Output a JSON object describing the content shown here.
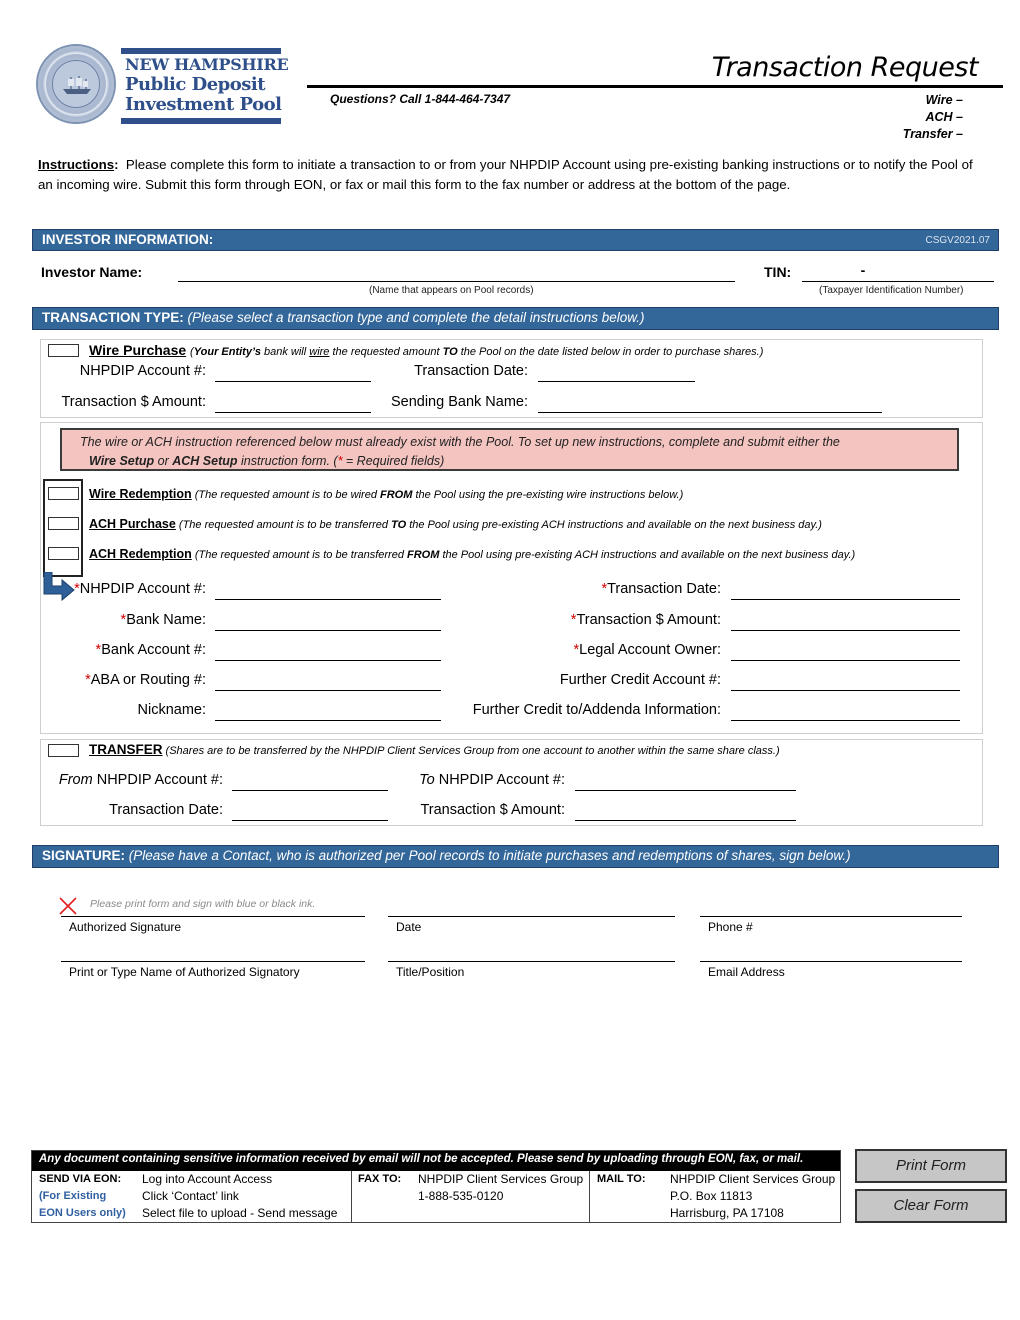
{
  "header": {
    "logo": {
      "line1": "NEW HAMPSHIRE",
      "line2": "Public Deposit",
      "line3": "Investment Pool"
    },
    "title": "Transaction Request",
    "questions": "Questions? Call 1-844-464-7347",
    "types": [
      "Wire –",
      "ACH –",
      "Transfer –"
    ]
  },
  "instructions": {
    "label": "Instructions",
    "text": "Please complete this form to initiate a transaction to or from your NHPDIP Account using pre-existing banking instructions or to notify the Pool of an incoming wire.  Submit this form through EON, or fax or mail this form to the fax number or address at the bottom of the page."
  },
  "investor": {
    "section_title": "INVESTOR INFORMATION:",
    "form_code": "CSGV2021.07",
    "name_label": "Investor Name:",
    "name_value": "",
    "name_hint": "(Name that appears on Pool records)",
    "tin_label": "TIN:",
    "tin_value": "-",
    "tin_hint": "(Taxpayer Identification Number)"
  },
  "transaction_type": {
    "section_title": "TRANSACTION TYPE:",
    "section_sub": "(Please select a transaction type and complete the detail instructions below.)"
  },
  "wire_purchase": {
    "title": "Wire Purchase",
    "desc_pre": "(",
    "desc_bold1": "Your Entity’s",
    "desc_mid1": " bank will ",
    "desc_u": "wire",
    "desc_mid2": " the requested amount ",
    "desc_bold2": "TO",
    "desc_post": " the Pool on the date listed below in order to purchase shares.)",
    "fields": {
      "account": "NHPDIP Account #:",
      "date": "Transaction Date:",
      "amount": "Transaction $ Amount:",
      "bank": "Sending Bank Name:"
    },
    "checked": false
  },
  "notice": {
    "line1": "The wire or ACH instruction referenced below must already exist with the Pool. To set up new instructions, complete and submit either the",
    "wire_setup": "Wire Setup",
    "or": " or ",
    "ach_setup": "ACH Setup",
    "mid": " instruction form. (",
    "star": "*",
    "tail": " = Required fields)"
  },
  "redemption_options": [
    {
      "title": "Wire Redemption",
      "pre": " (The requested amount is to be wired ",
      "bold": "FROM",
      "post": " the Pool using the pre-existing wire instructions below.)",
      "checked": false
    },
    {
      "title": "ACH Purchase",
      "pre": " (The requested amount is to be transferred ",
      "bold": "TO",
      "post": " the Pool using pre-existing ACH instructions and available on the next business day.)",
      "checked": false
    },
    {
      "title": "ACH Redemption",
      "pre": " (The requested amount is to be transferred ",
      "bold": "FROM",
      "post": " the Pool using pre-existing ACH instructions and available on the next business day.)",
      "checked": false
    }
  ],
  "detail_fields": {
    "left": [
      {
        "label": "NHPDIP Account #:",
        "required": true
      },
      {
        "label": "Bank Name:",
        "required": true
      },
      {
        "label": "Bank Account #:",
        "required": true
      },
      {
        "label": "ABA or Routing #:",
        "required": true
      },
      {
        "label": "Nickname:",
        "required": false
      }
    ],
    "right": [
      {
        "label": "Transaction Date:",
        "required": true
      },
      {
        "label": "Transaction $ Amount:",
        "required": true
      },
      {
        "label": "Legal Account Owner:",
        "required": true
      },
      {
        "label": "Further Credit Account #:",
        "required": false
      },
      {
        "label": "Further Credit to/Addenda Information:",
        "required": false
      }
    ],
    "star": "*"
  },
  "transfer": {
    "title": "TRANSFER",
    "desc": " (Shares are to be transferred by the NHPDIP Client Services Group from one account to another within the same share class.)",
    "from_italic": "From",
    "from_rest": " NHPDIP Account #:",
    "to_italic": "To",
    "to_rest": " NHPDIP Account #:",
    "date": "Transaction Date:",
    "amount": "Transaction $ Amount:",
    "checked": false
  },
  "signature": {
    "section_title": "SIGNATURE:",
    "section_sub": "(Please have a Contact, who is authorized per Pool records to initiate purchases and redemptions of shares, sign below.)",
    "ink_note": "Please print form and sign with blue or black ink.",
    "labels": [
      "Authorized Signature",
      "Date",
      "Phone #",
      "Print or Type Name of Authorized Signatory",
      "Title/Position",
      "Email Address"
    ]
  },
  "footer": {
    "warning": "Any document containing sensitive information received by email will not be accepted.  Please send by uploading through EON, fax, or mail.",
    "eon_label": "SEND VIA EON:",
    "eon_note1": "(For Existing",
    "eon_note2": "EON Users only)",
    "eon_steps": [
      "Log into Account Access",
      "Click ‘Contact’ link",
      "Select file to upload - Send message"
    ],
    "fax_label": "FAX TO:",
    "fax_lines": [
      "NHPDIP Client Services Group",
      "1-888-535-0120"
    ],
    "mail_label": "MAIL TO:",
    "mail_lines": [
      "NHPDIP Client Services Group",
      "P.O. Box 11813",
      "Harrisburg, PA 17108"
    ]
  },
  "buttons": {
    "print": "Print Form",
    "clear": "Clear Form"
  },
  "colors": {
    "section_blue": "#336699",
    "logo_blue": "#2f4f8a",
    "notice_pink": "#f4c4c0",
    "required_red": "#d00000"
  }
}
